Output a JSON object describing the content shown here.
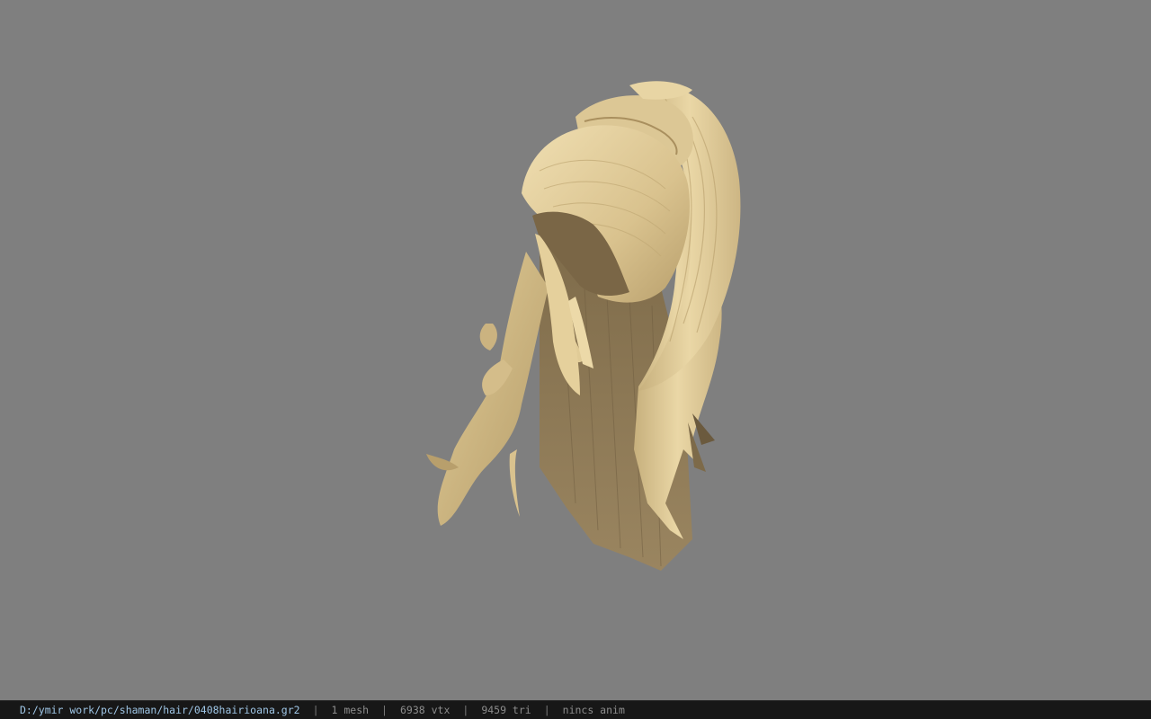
{
  "viewer": {
    "background_color": "#7f7f7f",
    "model_icon": "hair-mesh-icon",
    "hair_colors": {
      "light": "#e8d5a4",
      "mid": "#c9b27f",
      "dark": "#8a7451",
      "shadow": "#6b5a3e"
    }
  },
  "status": {
    "file_path": "D:/ymir work/pc/shaman/hair/0408hairioana.gr2",
    "separator": "|",
    "mesh_count": "1 mesh",
    "vertex_count": "6938 vtx",
    "triangle_count": "9459 tri",
    "anim_status": "nincs anim"
  }
}
